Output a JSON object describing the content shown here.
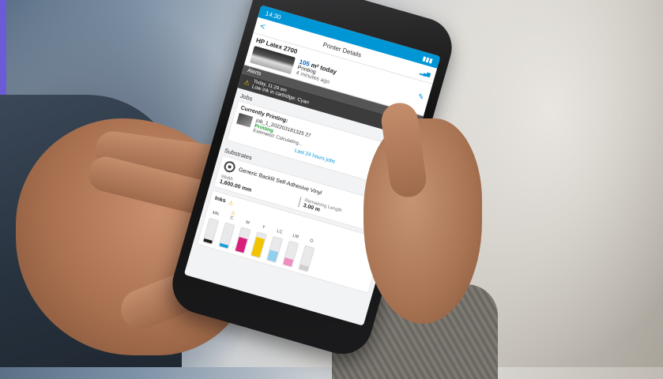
{
  "status_bar": {
    "time": "14:30"
  },
  "nav": {
    "title": "Printer Details",
    "back": "<",
    "edit_icon": "pencil-icon"
  },
  "printer": {
    "name": "HP Latex 2700",
    "progress_text": "105",
    "progress_suffix": "m² today",
    "status": "Printing",
    "ago": "4 minutes ago"
  },
  "alerts": {
    "header": "Alerts",
    "time": "Today, 11:29 am",
    "message": "Low ink in cartridge: Cyan"
  },
  "jobs": {
    "header": "Jobs",
    "currently_label": "Currently Printing:",
    "job_id": "job_1_202203181325 27",
    "job_status": "Printing",
    "estimated": "Estimated: Calculating...",
    "link": "Last 24 hours jobs"
  },
  "substrates": {
    "header": "Substrates",
    "name": "Generic Backlit Self-Adhesive Vinyl",
    "width_label": "Width",
    "width_value": "1,600.00 mm",
    "remaining_label": "Remaining Length",
    "remaining_value": "3.00 m"
  },
  "inks": {
    "header": "Inks",
    "items": [
      {
        "label": "MK",
        "color": "#222222",
        "level": 0.15,
        "warn": false
      },
      {
        "label": "C",
        "color": "#19a0d8",
        "level": 0.12,
        "warn": true
      },
      {
        "label": "M",
        "color": "#d6207a",
        "level": 0.6,
        "warn": false
      },
      {
        "label": "Y",
        "color": "#f2c400",
        "level": 0.8,
        "warn": false
      },
      {
        "label": "LC",
        "color": "#8fd0ee",
        "level": 0.45,
        "warn": false
      },
      {
        "label": "LM",
        "color": "#ee8ec0",
        "level": 0.3,
        "warn": false
      },
      {
        "label": "O",
        "color": "#cfcfcf",
        "level": 0.2,
        "warn": false
      }
    ]
  },
  "colors": {
    "accent": "#0096d6",
    "dark_bar": "#3c3c3c"
  }
}
